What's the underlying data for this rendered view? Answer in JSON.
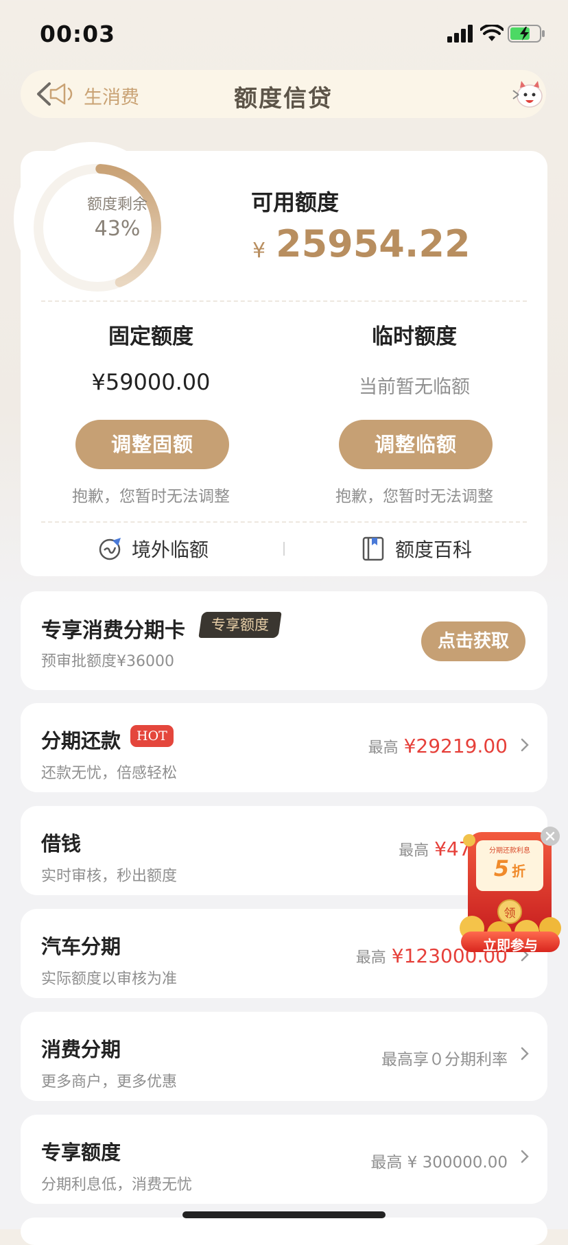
{
  "status_bar": {
    "time": "00:03"
  },
  "nav": {
    "notice": "生消费",
    "title": "额度信贷"
  },
  "credit": {
    "ring_label": "额度剩余",
    "ring_percent_text": "43%",
    "ring_fraction": 0.43,
    "available_label": "可用额度",
    "currency": "¥",
    "available_value": "25954.22",
    "fixed": {
      "title": "固定额度",
      "value": "¥59000.00",
      "button": "调整固额",
      "note": "抱歉，您暂时无法调整"
    },
    "temp": {
      "title": "临时额度",
      "value": "当前暂无临额",
      "button": "调整临额",
      "note": "抱歉，您暂时无法调整"
    },
    "links": [
      {
        "label": "境外临额"
      },
      {
        "label": "额度百科"
      }
    ]
  },
  "installment_card": {
    "title": "专享消费分期卡",
    "tag": "专享额度",
    "subtitle": "预审批额度¥36000",
    "cta": "点击获取"
  },
  "list": [
    {
      "title": "分期还款",
      "badge": "HOT",
      "subtitle": "还款无忧，倍感轻松",
      "prefix": "最高",
      "amount": "¥29219.00"
    },
    {
      "title": "借钱",
      "subtitle": "实时审核，秒出额度",
      "prefix": "最高",
      "amount": "¥47000"
    },
    {
      "title": "汽车分期",
      "subtitle": "实际额度以审核为准",
      "prefix": "最高",
      "amount": "¥123000.00"
    },
    {
      "title": "消费分期",
      "subtitle": "更多商户，更多优惠",
      "plain": "最高享０分期利率"
    },
    {
      "title": "专享额度",
      "subtitle": "分期利息低，消费无忧",
      "plain": "最高 ¥ 300000.00"
    }
  ],
  "promo": {
    "top_text": "分期还款利息",
    "discount": "5",
    "discount_unit": "折",
    "coin": "领",
    "button": "立即参与"
  },
  "colors": {
    "gold": "#c6a074",
    "amount_red": "#e6403a",
    "gold_text": "#b88e5f"
  }
}
